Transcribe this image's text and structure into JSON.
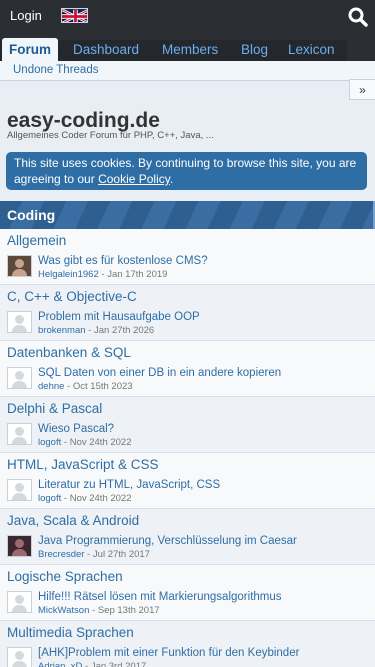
{
  "topbar": {
    "login_label": "Login",
    "language_flag": "uk-flag-icon",
    "search_icon": "search-icon"
  },
  "nav": {
    "tabs": [
      {
        "label": "Forum",
        "active": true
      },
      {
        "label": "Dashboard",
        "active": false
      },
      {
        "label": "Members",
        "active": false
      },
      {
        "label": "Blog",
        "active": false
      },
      {
        "label": "Lexicon",
        "active": false
      }
    ],
    "sub_item": "Undone Threads",
    "collapse_glyph": "»"
  },
  "site": {
    "title": "easy-coding.de",
    "subtitle": "Allgemeines Coder Forum für PHP, C++, Java, ..."
  },
  "cookie": {
    "text": "This site uses cookies. By continuing to browse this site, you are agreeing to our ",
    "link": "Cookie Policy",
    "end": "."
  },
  "category": {
    "title": "Coding"
  },
  "boards": [
    {
      "title": "Allgemein",
      "thread": "Was gibt es für kostenlose CMS?",
      "author": "Helgalein1962",
      "date": "Jan 17th 2019",
      "avatar": "photo"
    },
    {
      "title": "C, C++ & Objective-C",
      "thread": "Problem mit Hausaufgabe OOP",
      "author": "brokenman",
      "date": "Jan 27th 2026",
      "avatar": "default"
    },
    {
      "title": "Datenbanken & SQL",
      "thread": "SQL Daten von einer DB in ein andere kopieren",
      "author": "dehne",
      "date": "Oct 15th 2023",
      "avatar": "default"
    },
    {
      "title": "Delphi & Pascal",
      "thread": "Wieso Pascal?",
      "author": "logoft",
      "date": "Nov 24th 2022",
      "avatar": "default"
    },
    {
      "title": "HTML, JavaScript & CSS",
      "thread": "Literatur zu HTML, JavaScript, CSS",
      "author": "logoft",
      "date": "Nov 24th 2022",
      "avatar": "default"
    },
    {
      "title": "Java, Scala & Android",
      "thread": "Java Programmierung, Verschlüsselung im Caesar",
      "author": "Brecresder",
      "date": "Jul 27th 2017",
      "avatar": "photo2"
    },
    {
      "title": "Logische Sprachen",
      "thread": "Hilfe!!! Rätsel lösen mit Markierungsalgorithmus",
      "author": "MickWatson",
      "date": "Sep 13th 2017",
      "avatar": "default"
    },
    {
      "title": "Multimedia Sprachen",
      "thread": "[AHK]Problem mit einer Funktion für den Keybinder",
      "author": "Adrian_xD",
      "date": "Jan 3rd 2017",
      "avatar": "default"
    }
  ]
}
